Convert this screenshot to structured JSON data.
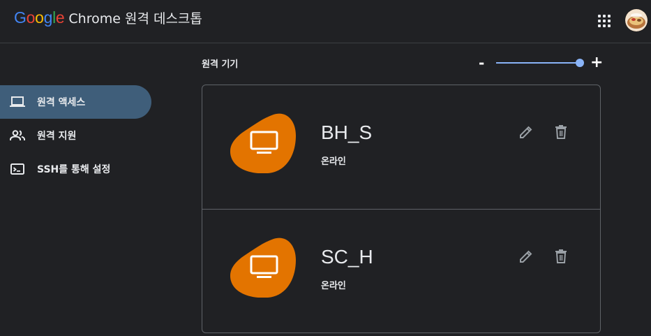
{
  "header": {
    "brand": "Google",
    "product": "Chrome 원격 데스크톱"
  },
  "colors": {
    "accent": "#8ab4f8",
    "active_nav": "#3f5e7a",
    "device_blob": "#e37400",
    "background": "#202124"
  },
  "sidebar": {
    "items": [
      {
        "label": "원격 액세스",
        "icon": "laptop-icon",
        "active": true
      },
      {
        "label": "원격 지원",
        "icon": "people-icon",
        "active": false
      },
      {
        "label": "SSH를 통해 설정",
        "icon": "terminal-icon",
        "active": false
      }
    ]
  },
  "main": {
    "section_title": "원격 기기",
    "zoom": {
      "minus": "-",
      "plus": "+",
      "level": 1.0
    },
    "devices": [
      {
        "name": "BH_S",
        "status": "온라인",
        "icon": "monitor-icon"
      },
      {
        "name": "SC_H",
        "status": "온라인",
        "icon": "monitor-icon"
      }
    ]
  }
}
